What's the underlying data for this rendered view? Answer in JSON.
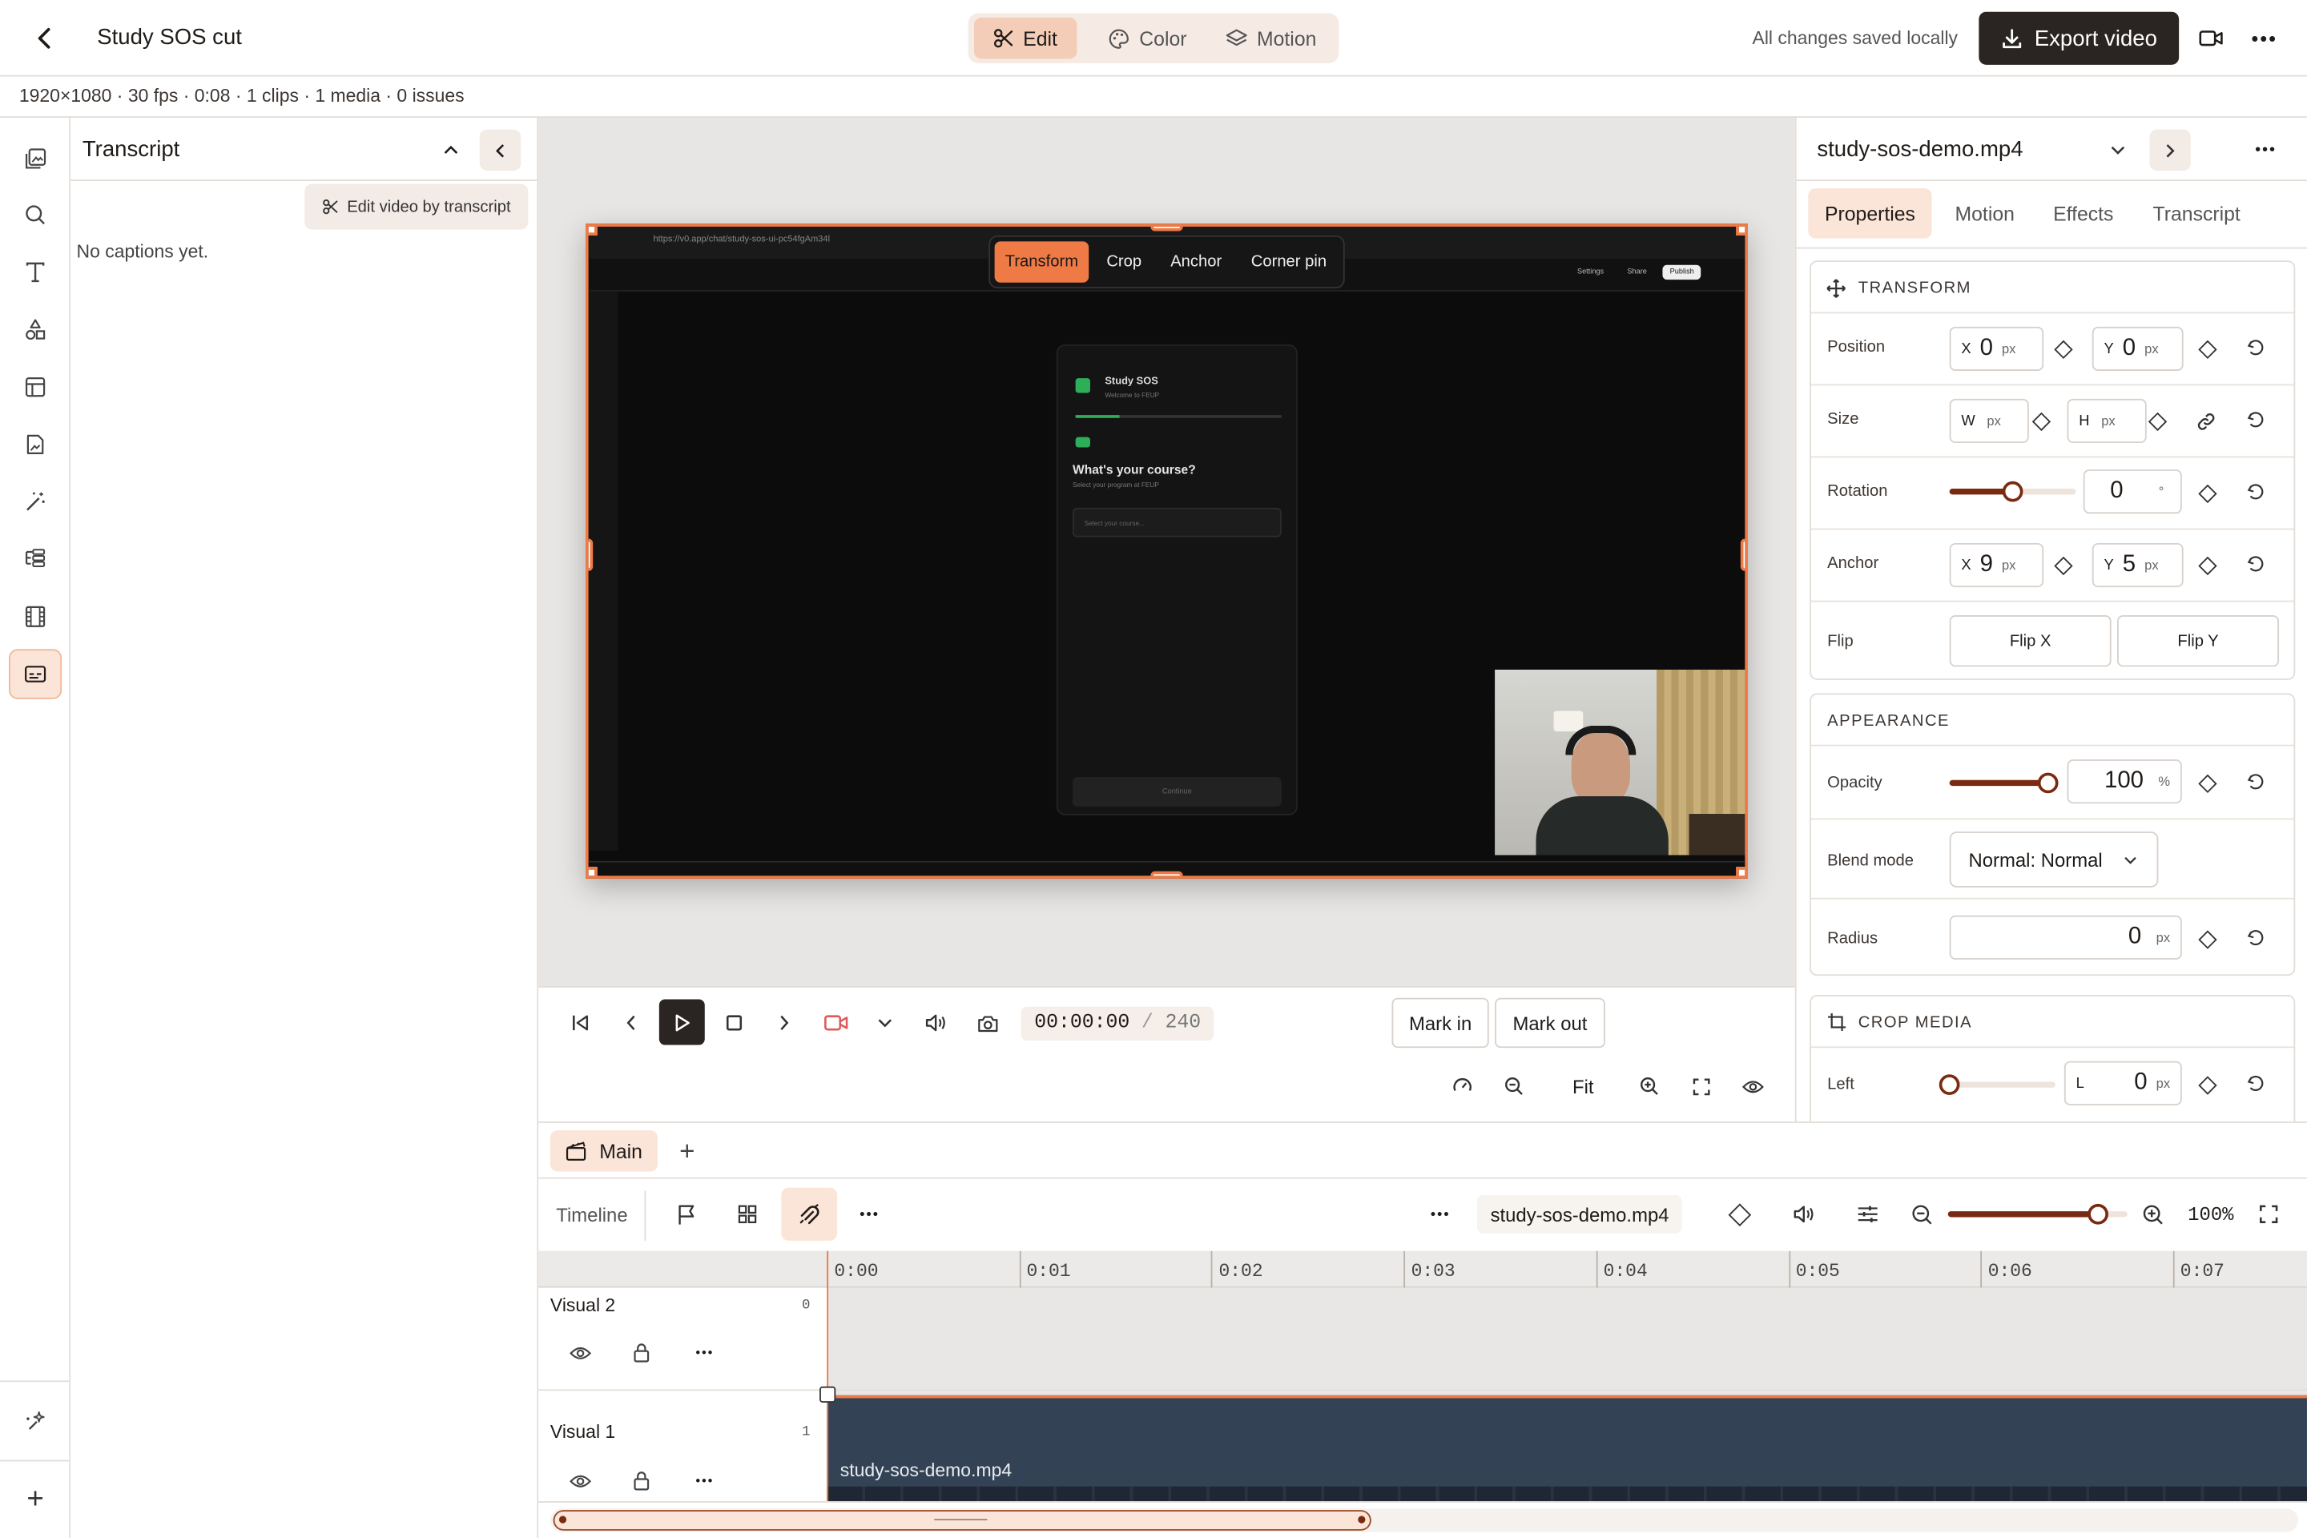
{
  "header": {
    "title": "Study SOS cut",
    "modes": [
      "Edit",
      "Color",
      "Motion"
    ],
    "save_status": "All changes saved locally",
    "export_label": "Export video"
  },
  "info_bar": "1920×1080 · 30 fps · 0:08 · 1 clips · 1 media · 0 issues",
  "left_rail_icons": [
    "media-icon",
    "search-icon",
    "text-icon",
    "shapes-icon",
    "layout-icon",
    "image-icon",
    "magic-wand-icon",
    "list-icon",
    "film-icon",
    "captions-icon"
  ],
  "transcript": {
    "title": "Transcript",
    "edit_button": "Edit video by transcript",
    "empty": "No captions yet."
  },
  "preview": {
    "tool_tabs": [
      "Transform",
      "Crop",
      "Anchor",
      "Corner pin"
    ],
    "active_tool": "Transform",
    "video": {
      "url": "https://v0.app/chat/study-sos-ui-pc54fgAm34l",
      "app_name": "Study SOS",
      "app_sub": "Welcome to FEUP",
      "question": "What's your course?",
      "question_sub": "Select your program at FEUP",
      "select_placeholder": "Select your course...",
      "continue": "Continue",
      "top_buttons": [
        "Settings",
        "Share",
        "Publish"
      ]
    }
  },
  "playback": {
    "timecode": "00:00:00",
    "total": "240",
    "separator": "/",
    "mark_in": "Mark in",
    "mark_out": "Mark out",
    "zoom_fit": "Fit"
  },
  "inspector": {
    "file": "study-sos-demo.mp4",
    "tabs": [
      "Properties",
      "Motion",
      "Effects",
      "Transcript"
    ],
    "active_tab": "Properties",
    "transform": {
      "title": "TRANSFORM",
      "position_label": "Position",
      "position": {
        "x": "0",
        "y": "0"
      },
      "size_label": "Size",
      "size": {
        "w_label": "W",
        "h_label": "H"
      },
      "rotation_label": "Rotation",
      "rotation_value": "0",
      "rotation_unit": "°",
      "rotation_slider": 0.5,
      "anchor_label": "Anchor",
      "anchor": {
        "x": "9",
        "y": "5"
      },
      "flip_label": "Flip",
      "flip_x": "Flip X",
      "flip_y": "Flip Y",
      "unit_px": "px",
      "x_label": "X",
      "y_label": "Y"
    },
    "appearance": {
      "title": "APPEARANCE",
      "opacity_label": "Opacity",
      "opacity_value": "100",
      "opacity_unit": "%",
      "opacity_slider": 1.0,
      "blend_label": "Blend mode",
      "blend_value": "Normal: Normal",
      "radius_label": "Radius",
      "radius_value": "0"
    },
    "crop": {
      "title": "CROP MEDIA",
      "left_label": "Left",
      "left_prefix": "L",
      "left_value": "0",
      "left_slider": 0.0
    }
  },
  "sequence_tabs": {
    "active": "Main"
  },
  "timeline": {
    "label": "Timeline",
    "clip_name": "study-sos-demo.mp4",
    "zoom": "100%",
    "zoom_slider": 0.84,
    "ruler": [
      "0:00",
      "0:01",
      "0:02",
      "0:03",
      "0:04",
      "0:05",
      "0:06",
      "0:07"
    ],
    "tracks": [
      {
        "name": "Visual 2",
        "index": "0"
      },
      {
        "name": "Visual 1",
        "index": "1"
      }
    ],
    "clips": [
      {
        "track": "Visual 1",
        "label": "study-sos-demo.mp4"
      }
    ]
  },
  "colors": {
    "accent": "#f07a45",
    "accent_soft": "#fbe4d8",
    "clip": "#334254",
    "dark_button": "#2a2522",
    "slider_fill": "#7a2a10"
  }
}
